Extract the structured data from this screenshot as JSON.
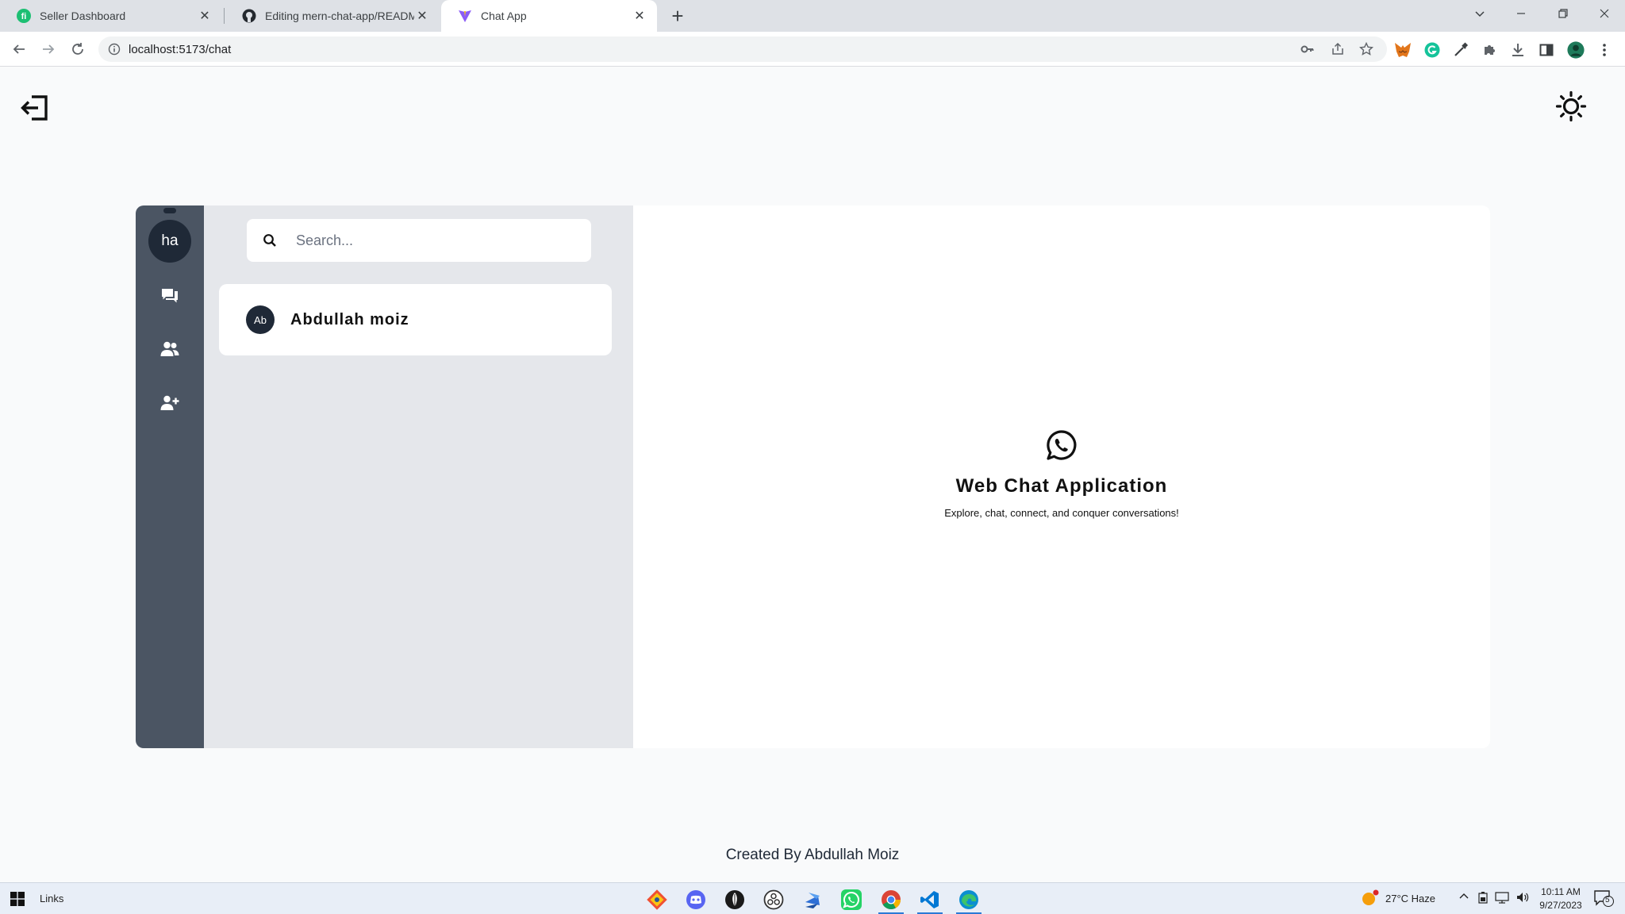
{
  "browser": {
    "tabs": [
      {
        "title": "Seller Dashboard",
        "favicon": "fiverr-icon",
        "active": false
      },
      {
        "title": "Editing mern-chat-app/README.md",
        "favicon": "github-icon",
        "active": false
      },
      {
        "title": "Chat App",
        "favicon": "vite-icon",
        "active": true
      }
    ],
    "url": "localhost:5173/chat"
  },
  "page": {
    "user_initials": "ha",
    "search_placeholder": "Search...",
    "contacts": [
      {
        "initials": "Ab",
        "name": "Abdullah moiz"
      }
    ],
    "welcome": {
      "title": "Web Chat Application",
      "subtitle": "Explore, chat, connect, and conquer conversations!"
    },
    "footer": "Created By Abdullah Moiz",
    "colors": {
      "rail": "#4b5563",
      "list_panel": "#e5e7eb",
      "avatar": "#1f2937",
      "page_bg": "#f9fafb"
    }
  },
  "taskbar": {
    "links_label": "Links",
    "weather": "27°C  Haze",
    "time": "10:11 AM",
    "date": "9/27/2023",
    "notifications": "5",
    "apps": [
      "git-app-icon",
      "discord-app-icon",
      "mongodb-app-icon",
      "obs-app-icon",
      "sublime-app-icon",
      "whatsapp-app-icon",
      "chrome-app-icon",
      "vscode-app-icon",
      "edge-app-icon"
    ]
  }
}
